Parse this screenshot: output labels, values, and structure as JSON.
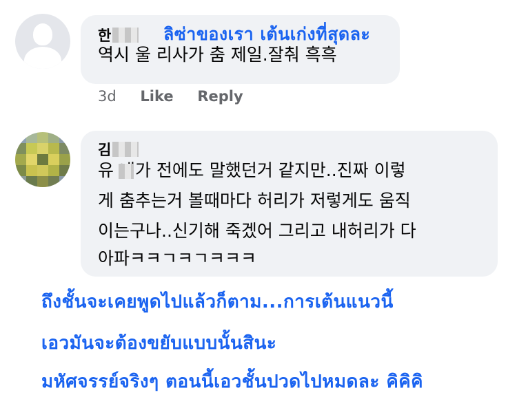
{
  "comment1": {
    "author": "한",
    "overlay_caption": "ลิซ่าของเรา เต้นเก่งที่สุดละ",
    "text": "역시 울 리사가 춤 제일.잘춰 흑흑",
    "time": "3d",
    "like_label": "Like",
    "reply_label": "Reply"
  },
  "comment2": {
    "author": "김",
    "lines": [
      "유  내가 전에도 말했던거 같지만..진짜 이렇",
      "게 춤추는거 볼때마다 허리가 저렇게도 움직",
      "이는구나..신기해 죽겠어 그리고 내허리가 다",
      "아파ㅋㅋㄱㅋㄱㅋㅋㅋ"
    ]
  },
  "translation": {
    "lines": [
      "ถึงชั้นจะเคยพูดไปแล้วก็ตาม...การเต้นแนวนี้",
      "เอวมันจะต้องขยับแบบนั้นสินะ",
      "มหัศจรรย์จริงๆ ตอนนี้เอวชั้นปวดไปหมดละ คิคิคิ"
    ]
  },
  "colors": {
    "overlay_text": "#1a63f0",
    "bubble": "#f0f2f5",
    "meta_text": "#65676b"
  }
}
